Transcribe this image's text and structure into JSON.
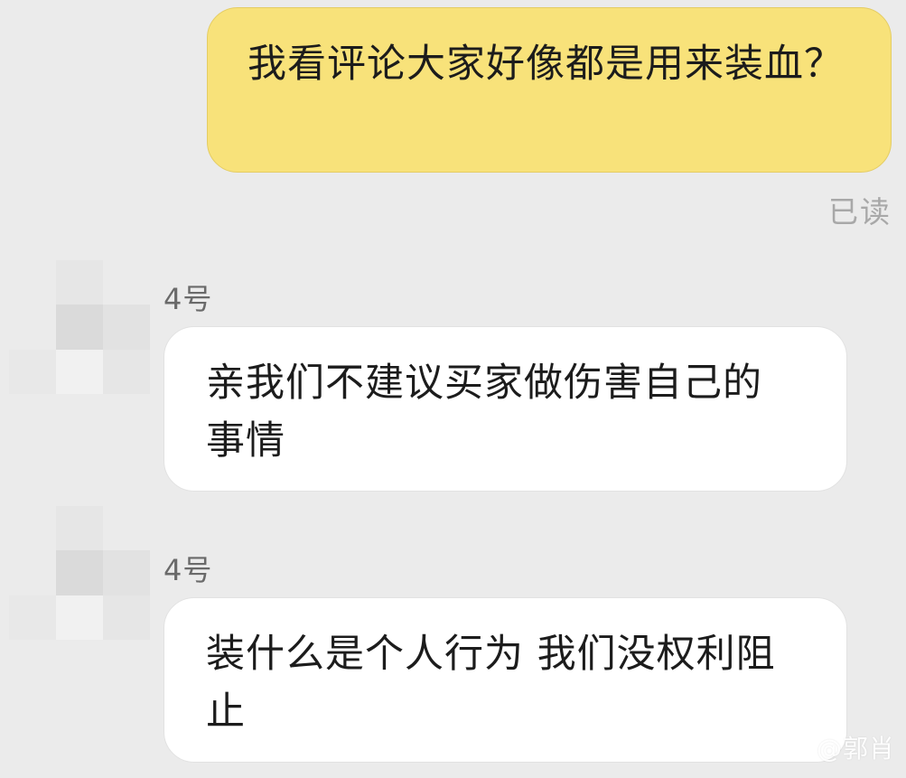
{
  "colors": {
    "background": "#ebebeb",
    "outgoing_bubble": "#f8e27a",
    "incoming_bubble": "#ffffff",
    "read_status": "#a8a8a8",
    "sender_name": "#6a6a6a"
  },
  "conversation": {
    "outgoing": {
      "text": "我看评论大家好像都是用来装血？",
      "status": "已读"
    },
    "incoming": [
      {
        "sender": "4号",
        "avatar_icon": "pixelated-avatar-icon",
        "text": "亲我们不建议买家做伤害自己的事情"
      },
      {
        "sender": "4号",
        "avatar_icon": "pixelated-avatar-icon",
        "text": "装什么是个人行为 我们没权利阻止"
      }
    ]
  },
  "watermark": {
    "text": "@郭肖"
  }
}
